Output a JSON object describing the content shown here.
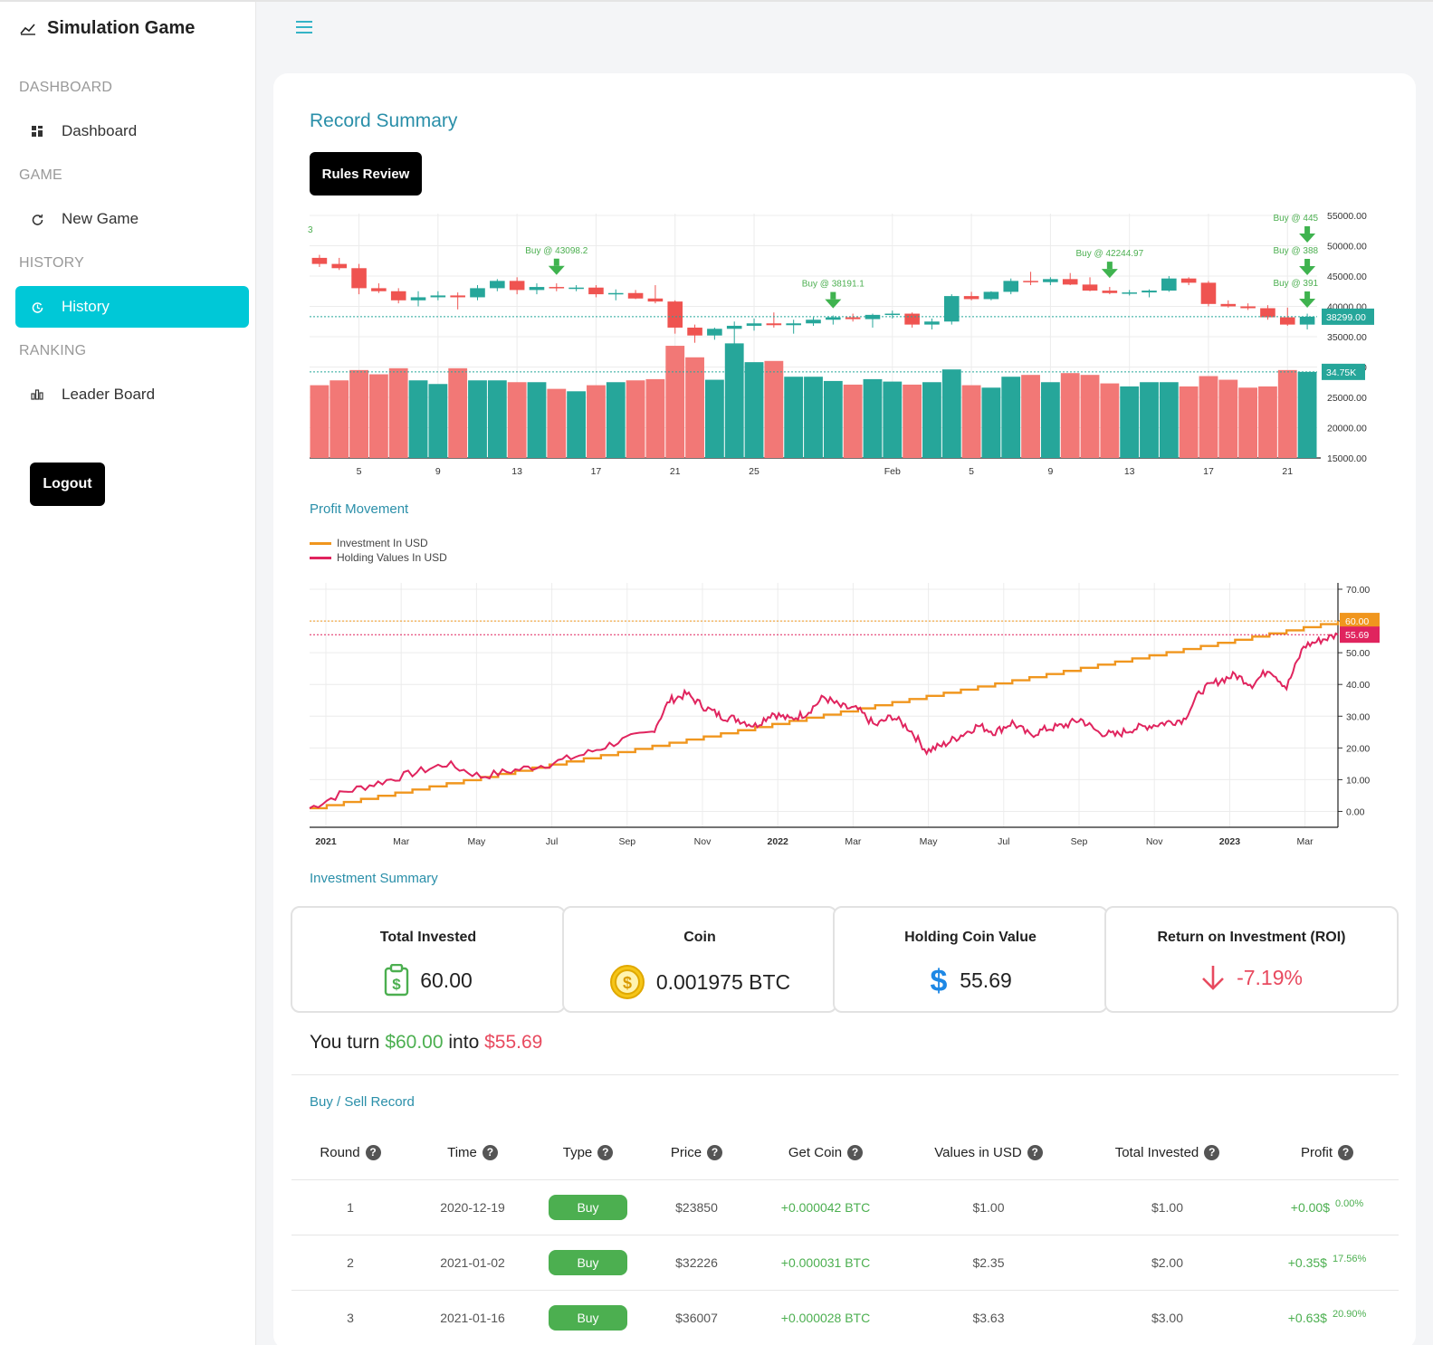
{
  "app": {
    "title": "Simulation Game"
  },
  "sidebar": {
    "sections": [
      {
        "label": "DASHBOARD",
        "item": "Dashboard",
        "icon": "grid-icon"
      },
      {
        "label": "GAME",
        "item": "New Game",
        "icon": "refresh-icon"
      },
      {
        "label": "HISTORY",
        "item": "History",
        "icon": "history-icon"
      },
      {
        "label": "RANKING",
        "item": "Leader Board",
        "icon": "bar-chart-icon"
      }
    ],
    "logout_label": "Logout"
  },
  "main": {
    "record_title": "Record Summary",
    "rules_button": "Rules Review",
    "profit_title": "Profit Movement",
    "investment_title": "Investment Summary",
    "record_label": "Buy / Sell Record"
  },
  "colors": {
    "accent": "#00c8d7",
    "up": "#26a69a",
    "down": "#ef5350",
    "investment": "#f0961e",
    "holding": "#e0245e",
    "buy_marker": "#4caf50"
  },
  "chart_data": [
    {
      "type": "candlestick",
      "x_tick_labels": [
        "5",
        "9",
        "13",
        "17",
        "21",
        "25",
        "Feb",
        "5",
        "9",
        "13",
        "17",
        "21"
      ],
      "y_tick_labels": [
        "55000.00",
        "50000.00",
        "45000.00",
        "40000.00",
        "35000.00",
        "30000.00",
        "25000.00",
        "20000.00",
        "15000.00"
      ],
      "ylim": [
        15000,
        55000
      ],
      "last_price_label": "38299.00",
      "last_price": 38299,
      "volume_label": "34.75K",
      "edge_label": "3",
      "annotations": [
        {
          "text": "Buy @ 43098.2",
          "index": 12
        },
        {
          "text": "Buy @ 38191.1",
          "index": 26
        },
        {
          "text": "Buy @ 42244.97",
          "index": 40
        },
        {
          "text": "Buy @ 445",
          "index": 50
        },
        {
          "text": "Buy @ 388",
          "index": 50
        },
        {
          "text": "Buy @ 391",
          "index": 50
        }
      ],
      "candles": [
        [
          48000,
          48500,
          46500,
          47000
        ],
        [
          47000,
          48000,
          46000,
          46300
        ],
        [
          46300,
          47000,
          42000,
          43000
        ],
        [
          43000,
          43800,
          42200,
          42500
        ],
        [
          42500,
          43000,
          40500,
          41000
        ],
        [
          41000,
          42500,
          40000,
          41500
        ],
        [
          41500,
          42500,
          41000,
          41800
        ],
        [
          41800,
          42300,
          39500,
          41500
        ],
        [
          41500,
          43500,
          41000,
          43000
        ],
        [
          43000,
          44500,
          42500,
          44200
        ],
        [
          44200,
          44800,
          42000,
          42700
        ],
        [
          42700,
          43800,
          42000,
          43200
        ],
        [
          43200,
          43800,
          42500,
          43000
        ],
        [
          43000,
          43500,
          42500,
          43100
        ],
        [
          43100,
          43500,
          41500,
          42000
        ],
        [
          42000,
          42800,
          41000,
          42200
        ],
        [
          42200,
          42700,
          41200,
          41300
        ],
        [
          41300,
          43500,
          40500,
          40800
        ],
        [
          40800,
          41000,
          35500,
          36500
        ],
        [
          36500,
          37000,
          34000,
          35200
        ],
        [
          35200,
          36500,
          34500,
          36300
        ],
        [
          36300,
          37500,
          33000,
          36800
        ],
        [
          36800,
          38000,
          36000,
          37200
        ],
        [
          37200,
          39000,
          36500,
          36900
        ],
        [
          36900,
          37800,
          35500,
          37200
        ],
        [
          37200,
          38200,
          36800,
          37800
        ],
        [
          37800,
          38500,
          37000,
          38200
        ],
        [
          38200,
          38800,
          37500,
          37900
        ],
        [
          37900,
          38800,
          36500,
          38600
        ],
        [
          38600,
          39300,
          38000,
          38800
        ],
        [
          38800,
          39000,
          36500,
          37000
        ],
        [
          37000,
          38000,
          36200,
          37500
        ],
        [
          37500,
          42000,
          37000,
          41700
        ],
        [
          41700,
          42400,
          41000,
          41200
        ],
        [
          41200,
          42500,
          41000,
          42400
        ],
        [
          42400,
          44600,
          42000,
          44200
        ],
        [
          44200,
          45700,
          43500,
          44000
        ],
        [
          44000,
          44800,
          43500,
          44500
        ],
        [
          44500,
          45500,
          43500,
          43600
        ],
        [
          43600,
          44800,
          42500,
          42600
        ],
        [
          42600,
          43200,
          42000,
          42200
        ],
        [
          42200,
          42700,
          41800,
          42300
        ],
        [
          42300,
          42800,
          41500,
          42600
        ],
        [
          42600,
          45000,
          42400,
          44600
        ],
        [
          44600,
          44800,
          43500,
          43900
        ],
        [
          43900,
          44200,
          40000,
          40400
        ],
        [
          40400,
          41000,
          39800,
          40000
        ],
        [
          40000,
          40500,
          39400,
          39700
        ],
        [
          39700,
          40200,
          37800,
          38200
        ],
        [
          38200,
          39800,
          36800,
          37000
        ],
        [
          37000,
          38800,
          36200,
          38299
        ]
      ],
      "volumes": [
        12000,
        12800,
        14500,
        13800,
        14800,
        12800,
        12200,
        14800,
        12800,
        12800,
        12500,
        12500,
        11400,
        11000,
        12000,
        12500,
        12800,
        13000,
        18500,
        16600,
        12900,
        18900,
        15800,
        16000,
        13400,
        13400,
        12700,
        12100,
        13000,
        12600,
        12100,
        12500,
        14600,
        12000,
        11600,
        13400,
        13700,
        12500,
        14000,
        13700,
        12300,
        11800,
        12500,
        12500,
        11800,
        13500,
        12900,
        11600,
        11800,
        14500,
        14200
      ]
    },
    {
      "type": "line",
      "x_tick_labels": [
        "2021",
        "Mar",
        "May",
        "Jul",
        "Sep",
        "Nov",
        "2022",
        "Mar",
        "May",
        "Jul",
        "Sep",
        "Nov",
        "2023",
        "Mar"
      ],
      "y_tick_labels": [
        "70.00",
        "60.00",
        "50.00",
        "40.00",
        "30.00",
        "20.00",
        "10.00",
        "0.00"
      ],
      "ylim": [
        -5,
        72
      ],
      "series": [
        {
          "name": "Investment In USD",
          "color": "#f0961e",
          "last_label": "60.00",
          "x": [
            0,
            60
          ],
          "values": [
            1,
            60
          ]
        },
        {
          "name": "Holding Values In USD",
          "color": "#e0245e",
          "last_label": "55.69",
          "x": [
            0,
            2,
            4,
            6,
            8,
            10,
            12,
            14,
            16,
            18,
            20,
            21,
            22,
            23,
            24,
            25,
            26,
            27,
            28,
            29,
            30,
            31,
            32,
            33,
            34,
            35,
            36,
            37,
            38,
            39,
            40,
            41,
            42,
            43,
            44,
            45,
            46,
            47,
            48,
            49,
            50,
            51,
            52,
            53,
            54,
            55,
            56,
            57,
            58,
            59,
            60
          ],
          "values": [
            1,
            6,
            9,
            12,
            15,
            11,
            13,
            15,
            18,
            22,
            25,
            35,
            37,
            33,
            30,
            29,
            27,
            31,
            29,
            31,
            36,
            33,
            32,
            27,
            30,
            26,
            19,
            21,
            24,
            27,
            25,
            28,
            24,
            26,
            27,
            29,
            25,
            24,
            26,
            27,
            28,
            29,
            38,
            41,
            43,
            40,
            45,
            39,
            52,
            54,
            55.69
          ]
        }
      ]
    }
  ],
  "summary": {
    "total_invested": {
      "label": "Total Invested",
      "value": "60.00",
      "icon": "clipboard-dollar-icon"
    },
    "coin": {
      "label": "Coin",
      "value": "0.001975 BTC",
      "icon": "coin-icon"
    },
    "holding": {
      "label": "Holding Coin Value",
      "value": "55.69",
      "icon": "dollar-icon"
    },
    "roi": {
      "label": "Return on Investment (ROI)",
      "value": "-7.19%",
      "icon": "arrow-down-icon"
    }
  },
  "turn": {
    "prefix": "You turn",
    "from": "$60.00",
    "mid": "into",
    "to": "$55.69"
  },
  "table": {
    "headers": [
      "Round",
      "Time",
      "Type",
      "Price",
      "Get Coin",
      "Values in USD",
      "Total Invested",
      "Profit"
    ],
    "rows": [
      {
        "round": "1",
        "time": "2020-12-19",
        "type": "Buy",
        "price": "$23850",
        "coin": "+0.000042 BTC",
        "value": "$1.00",
        "invested": "$1.00",
        "profit": "+0.00$",
        "pct": "0.00%"
      },
      {
        "round": "2",
        "time": "2021-01-02",
        "type": "Buy",
        "price": "$32226",
        "coin": "+0.000031 BTC",
        "value": "$2.35",
        "invested": "$2.00",
        "profit": "+0.35$",
        "pct": "17.56%"
      },
      {
        "round": "3",
        "time": "2021-01-16",
        "type": "Buy",
        "price": "$36007",
        "coin": "+0.000028 BTC",
        "value": "$3.63",
        "invested": "$3.00",
        "profit": "+0.63$",
        "pct": "20.90%"
      }
    ]
  }
}
